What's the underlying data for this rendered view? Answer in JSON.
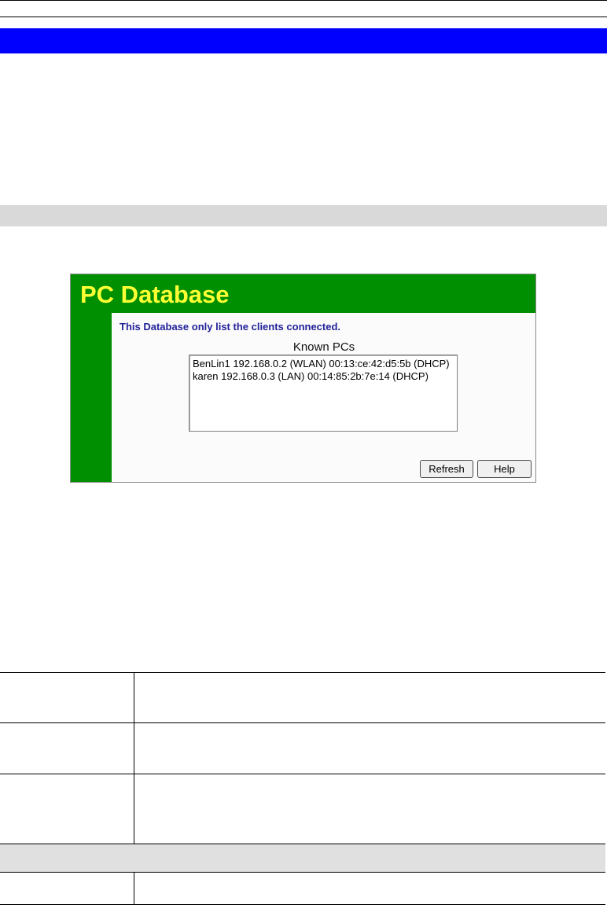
{
  "screenshot": {
    "title": "PC Database",
    "note": "This Database only list the clients connected.",
    "list_caption": "Known PCs",
    "known_pcs": [
      "BenLin1 192.168.0.2 (WLAN) 00:13:ce:42:d5:5b (DHCP)",
      "karen 192.168.0.3 (LAN) 00:14:85:2b:7e:14 (DHCP)"
    ],
    "buttons": {
      "refresh": "Refresh",
      "help": "Help"
    }
  },
  "colors": {
    "header_bar": "#0000ff",
    "screen_title": "#ffff33",
    "screen_background": "#008f00",
    "note_text": "#22229a"
  }
}
